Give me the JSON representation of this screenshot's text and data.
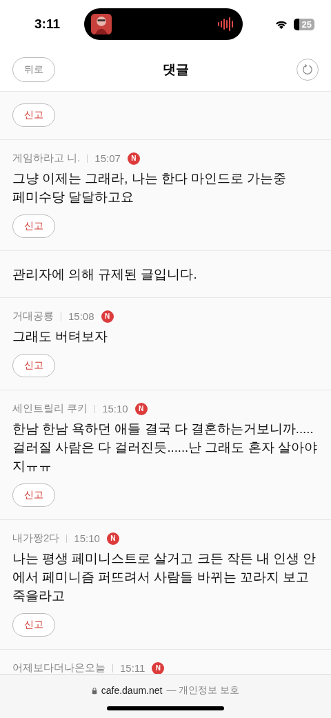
{
  "status_bar": {
    "time": "3:11",
    "battery": "25"
  },
  "header": {
    "back": "뒤로",
    "title": "댓글"
  },
  "comments": [
    {
      "kind": "comment",
      "report": "신고"
    },
    {
      "kind": "comment",
      "author": "게임하라고 니.",
      "time": "15:07",
      "new": true,
      "badge": "N",
      "text": "그냥 이제는 그래라, 나는 한다 마인드로 가는중\n페미수당 달달하고요",
      "report": "신고"
    },
    {
      "kind": "notice",
      "text": "관리자에 의해 규제된 글입니다."
    },
    {
      "kind": "comment",
      "author": "거대공룡",
      "time": "15:08",
      "new": true,
      "badge": "N",
      "text": "그래도 버텨보자",
      "report": "신고"
    },
    {
      "kind": "comment",
      "author": "세인트릴리 쿠키",
      "time": "15:10",
      "new": true,
      "badge": "N",
      "text": "한남 한남 욕하던 애들 결국 다 결혼하는거보니까.....걸러질 사람은 다 걸러진듯......난 그래도 혼자 살아야지ㅠㅠ",
      "report": "신고"
    },
    {
      "kind": "comment",
      "author": "내가짱2다",
      "time": "15:10",
      "new": true,
      "badge": "N",
      "text": "나는 평생 페미니스트로 살거고 크든 작든 내 인생 안에서 페미니즘 퍼뜨려서 사람들 바뀌는 꼬라지 보고 죽을라고",
      "report": "신고"
    },
    {
      "kind": "comment",
      "author": "어제보다더나은오늘",
      "time": "15:11",
      "new": true,
      "badge": "N"
    }
  ],
  "footer": {
    "domain": "cafe.daum.net",
    "note": "— 개인정보 보호"
  }
}
